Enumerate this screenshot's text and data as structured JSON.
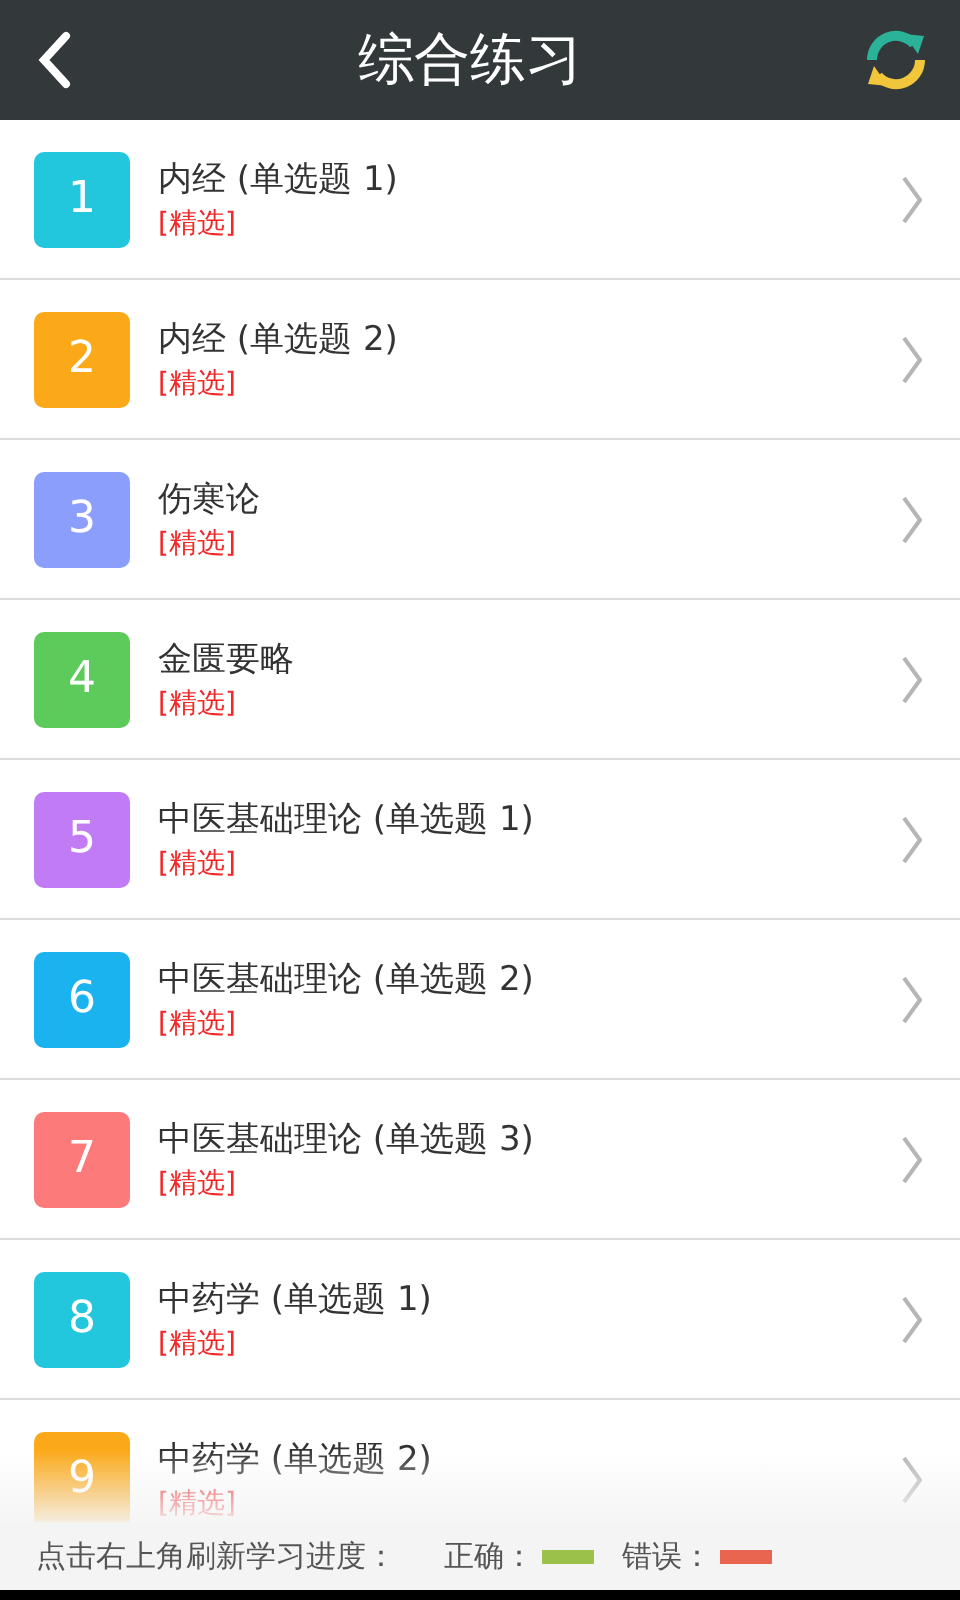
{
  "header": {
    "title": "综合练习"
  },
  "items": [
    {
      "number": "1",
      "title": "内经 (单选题 1)",
      "tag": "[精选]",
      "color": "#22c7dd"
    },
    {
      "number": "2",
      "title": "内经 (单选题 2)",
      "tag": "[精选]",
      "color": "#fba919"
    },
    {
      "number": "3",
      "title": "伤寒论",
      "tag": "[精选]",
      "color": "#8c9efb"
    },
    {
      "number": "4",
      "title": "金匮要略",
      "tag": "[精选]",
      "color": "#5ccb5c"
    },
    {
      "number": "5",
      "title": "中医基础理论 (单选题 1)",
      "tag": "[精选]",
      "color": "#c17cf5"
    },
    {
      "number": "6",
      "title": "中医基础理论 (单选题 2)",
      "tag": "[精选]",
      "color": "#1ab3ef"
    },
    {
      "number": "7",
      "title": "中医基础理论 (单选题 3)",
      "tag": "[精选]",
      "color": "#fd7a7a"
    },
    {
      "number": "8",
      "title": "中药学 (单选题 1)",
      "tag": "[精选]",
      "color": "#22c7dd"
    },
    {
      "number": "9",
      "title": "中药学 (单选题 2)",
      "tag": "[精选]",
      "color": "#fba919"
    }
  ],
  "footer": {
    "hint": "点击右上角刷新学习进度：",
    "legend": [
      {
        "label": "正确：",
        "color": "#9bc14a"
      },
      {
        "label": "错误：",
        "color": "#e8654f"
      }
    ]
  }
}
